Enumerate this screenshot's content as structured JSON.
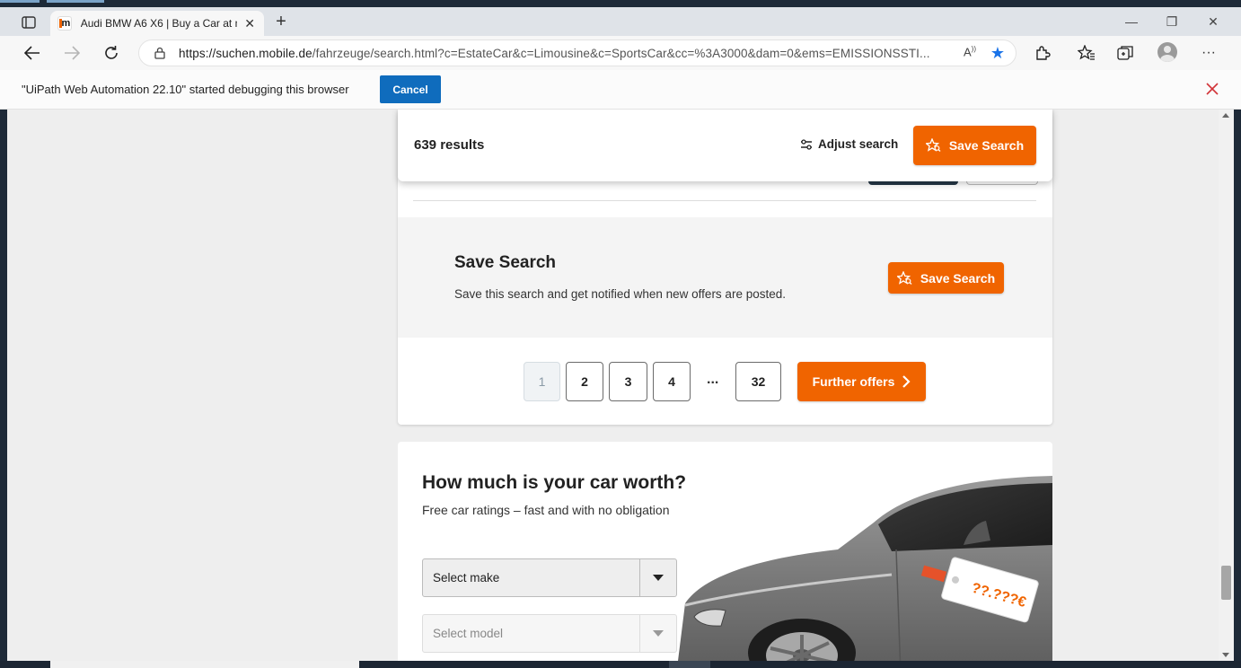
{
  "browser": {
    "tab_title": "Audi BMW A6 X6 | Buy a Car at m",
    "favicon_letter": "m",
    "url_host": "https://suchen.mobile.de",
    "url_path": "/fahrzeuge/search.html?c=EstateCar&c=Limousine&c=SportsCar&cc=%3A3000&dam=0&ems=EMISSIONSSTI...",
    "accent": "#1a73e8"
  },
  "infobar": {
    "message": "\"UiPath Web Automation 22.10\" started debugging this browser",
    "cancel_label": "Cancel"
  },
  "sticky_bar": {
    "result_count": "639 results",
    "adjust_label": "Adjust search",
    "save_label": "Save Search"
  },
  "save_panel": {
    "title": "Save Search",
    "description": "Save this search and get notified when new offers are posted.",
    "button_label": "Save Search"
  },
  "pagination": {
    "pages": [
      "1",
      "2",
      "3",
      "4"
    ],
    "ellipsis": "...",
    "last_page": "32",
    "current": "1",
    "further_label": "Further offers"
  },
  "valuation": {
    "title": "How much is your car worth?",
    "subtitle": "Free car ratings – fast and with no obligation",
    "make_placeholder": "Select make",
    "model_placeholder": "Select model",
    "price_tag": "??.???€"
  },
  "colors": {
    "brand_orange": "#f06400",
    "cancel_blue": "#0f6cbd",
    "close_red": "#d13438"
  }
}
